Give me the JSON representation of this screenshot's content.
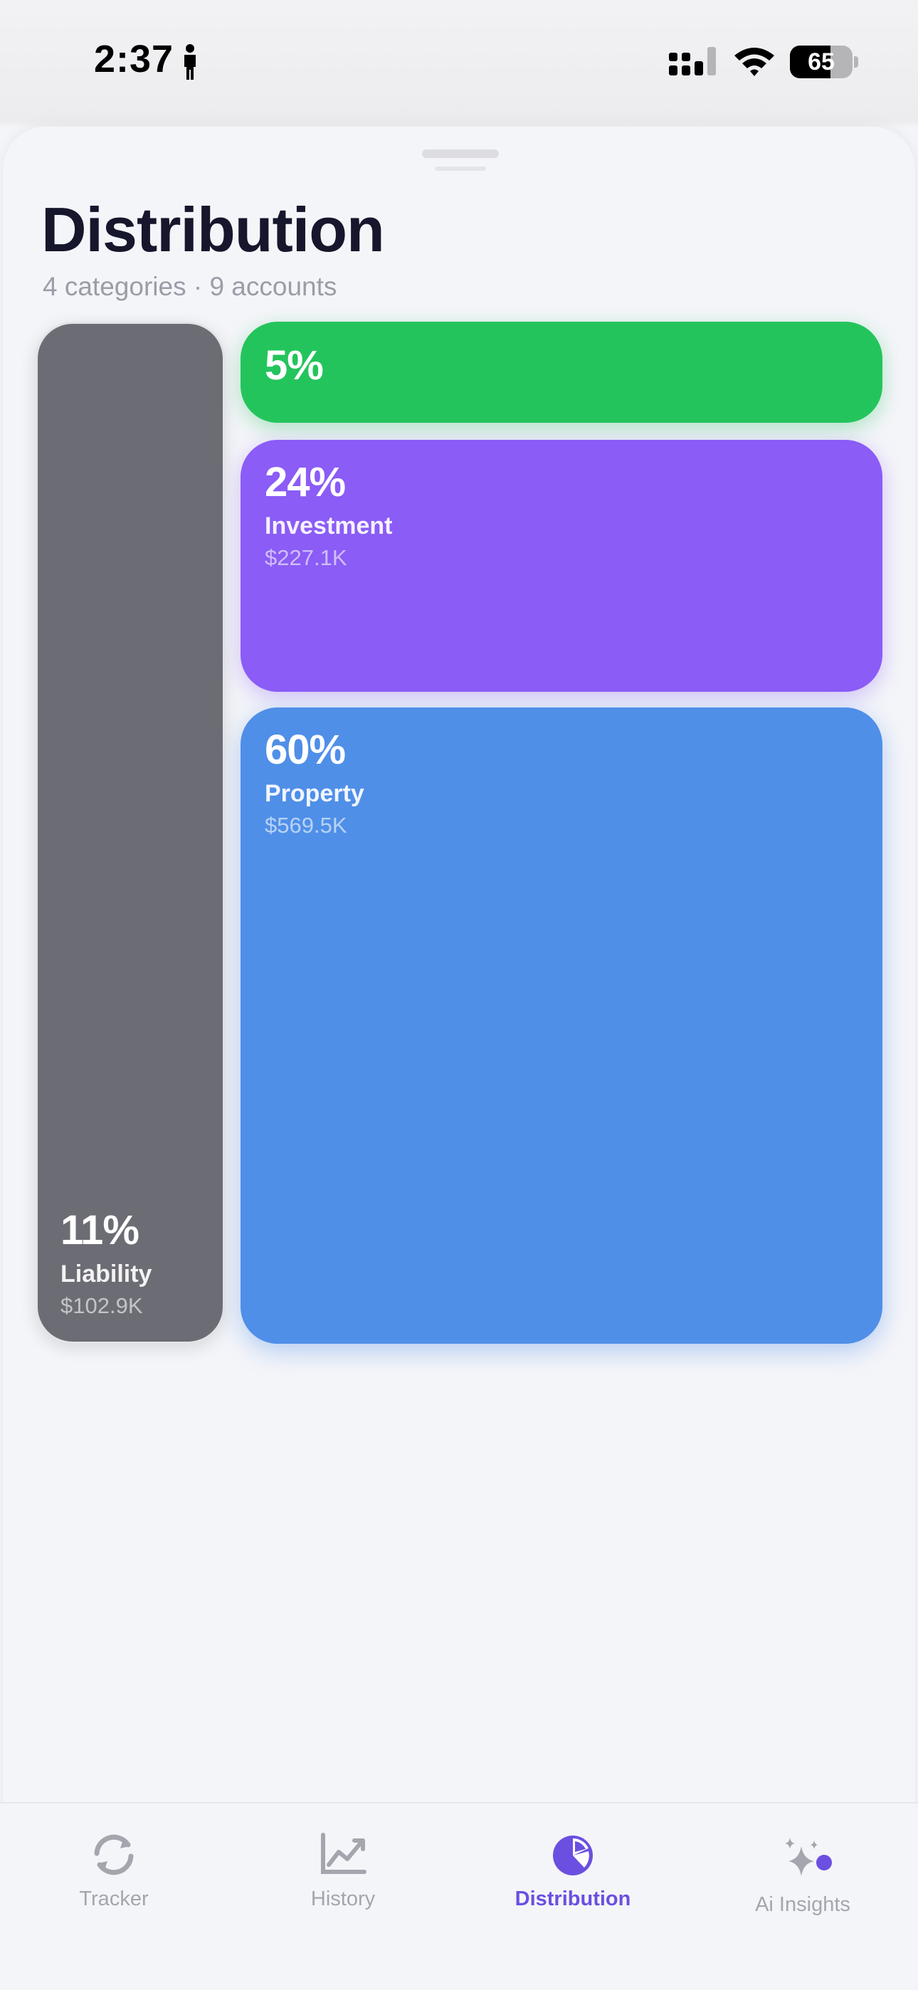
{
  "status_bar": {
    "time": "2:37",
    "battery_level": "65",
    "battery_fraction": 0.65
  },
  "header": {
    "title": "Distribution",
    "subtitle": "4 categories · 9 accounts"
  },
  "tiles": {
    "liability": {
      "percent": "11%",
      "label": "Liability",
      "amount": "$102.9K",
      "color": "#6c6c74"
    },
    "cash": {
      "percent": "5%",
      "color": "#24c45c"
    },
    "investment": {
      "percent": "24%",
      "label": "Investment",
      "amount": "$227.1K",
      "color": "#8b5cf6"
    },
    "property": {
      "percent": "60%",
      "label": "Property",
      "amount": "$569.5K",
      "color": "#4f8fe8"
    }
  },
  "tabbar": {
    "accent_color": "#6b4fe0",
    "items": [
      {
        "label": "Tracker",
        "icon": "refresh-icon",
        "active": false
      },
      {
        "label": "History",
        "icon": "line-chart-icon",
        "active": false
      },
      {
        "label": "Distribution",
        "icon": "pie-chart-icon",
        "active": true
      },
      {
        "label": "Ai Insights",
        "icon": "sparkles-icon",
        "active": false
      }
    ]
  }
}
